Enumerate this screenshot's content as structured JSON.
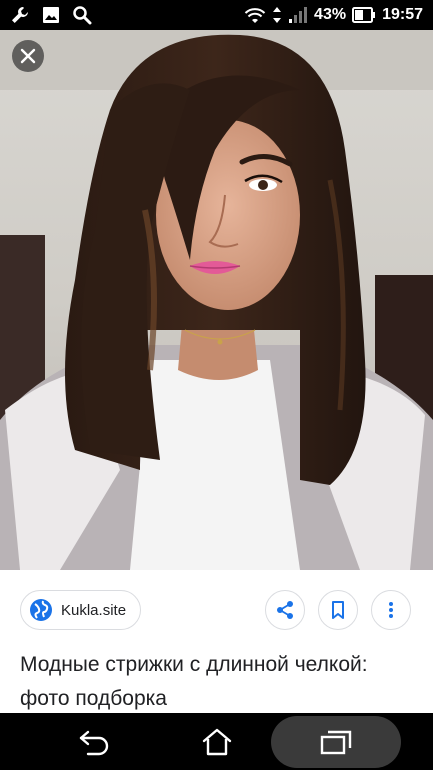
{
  "status_bar": {
    "battery": "43%",
    "time": "19:57",
    "icons": [
      "wrench-icon",
      "image-icon",
      "search-icon",
      "wifi-icon",
      "data-arrows-icon",
      "signal-icon",
      "battery-icon"
    ]
  },
  "viewer": {
    "close_icon": "close-icon"
  },
  "info": {
    "source_name": "Kukla.site",
    "title": "Модные стрижки с длинной челкой: фото подборка",
    "actions": [
      "share-icon",
      "bookmark-icon",
      "more-vert-icon"
    ]
  },
  "nav": {
    "items": [
      "back-icon",
      "home-icon",
      "recents-icon"
    ]
  },
  "colors": {
    "accent": "#1a73e8",
    "chip_border": "#dadce0",
    "text": "#202124"
  }
}
